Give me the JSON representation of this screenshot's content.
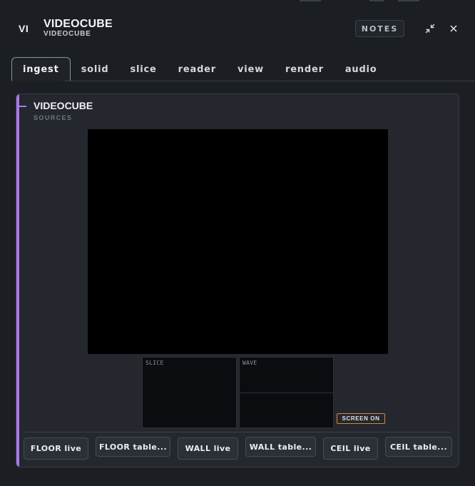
{
  "app": {
    "badge": "VI",
    "title": "VIDEOCUBE",
    "subtitle": "VIDEOCUBE"
  },
  "header": {
    "notes_label": "NOTES",
    "minimize_icon": "minimize-icon",
    "close_icon": "close-icon"
  },
  "tabs": [
    {
      "label": "ingest",
      "active": true
    },
    {
      "label": "solid",
      "active": false
    },
    {
      "label": "slice",
      "active": false
    },
    {
      "label": "reader",
      "active": false
    },
    {
      "label": "view",
      "active": false
    },
    {
      "label": "render",
      "active": false
    },
    {
      "label": "audio",
      "active": false
    }
  ],
  "panel": {
    "title": "VIDEOCUBE",
    "subtitle": "SOURCES",
    "slice_label": "SLICE",
    "wave_label": "WAVE",
    "screen_status": "SCREEN ON",
    "source_buttons": [
      "FLOOR live",
      "FLOOR table...",
      "WALL live",
      "WALL table...",
      "CEIL live",
      "CEIL table..."
    ]
  },
  "colors": {
    "background": "#1b1e23",
    "panel": "#24272d",
    "accent": "#a978ea",
    "screen_on_border": "#d28a2f"
  }
}
